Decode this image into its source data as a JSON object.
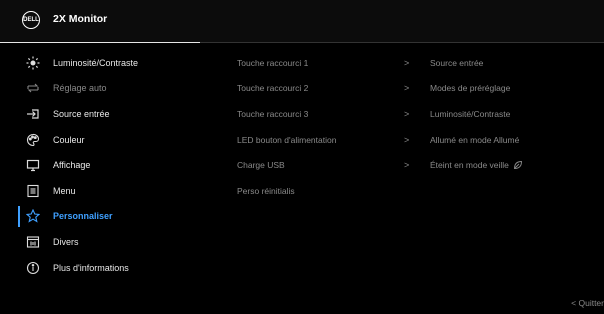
{
  "header": {
    "logo_text": "DELL",
    "title": "2X Monitor"
  },
  "sidebar": {
    "items": [
      {
        "label": "Luminosité/Contraste",
        "icon": "brightness-icon"
      },
      {
        "label": "Réglage auto",
        "icon": "auto-adjust-icon"
      },
      {
        "label": "Source entrée",
        "icon": "input-source-icon"
      },
      {
        "label": "Couleur",
        "icon": "color-palette-icon"
      },
      {
        "label": "Affichage",
        "icon": "display-icon"
      },
      {
        "label": "Menu",
        "icon": "menu-icon"
      },
      {
        "label": "Personnaliser",
        "icon": "star-icon"
      },
      {
        "label": "Divers",
        "icon": "others-icon"
      },
      {
        "label": "Plus d'informations",
        "icon": "info-icon"
      }
    ]
  },
  "middle": {
    "items": [
      {
        "label": "Touche raccourci 1",
        "chevron": ">"
      },
      {
        "label": "Touche raccourci 2",
        "chevron": ">"
      },
      {
        "label": "Touche raccourci 3",
        "chevron": ">"
      },
      {
        "label": "LED bouton d'alimentation",
        "chevron": ">"
      },
      {
        "label": "Charge USB",
        "chevron": ">"
      },
      {
        "label": "Perso réinitialis",
        "chevron": ""
      }
    ]
  },
  "right": {
    "items": [
      "Source entrée",
      "Modes de préréglage",
      "Luminosité/Contraste",
      "Allumé en mode Allumé",
      "Éteint en mode veille"
    ]
  },
  "footer": {
    "exit_label": "< Quitter"
  },
  "colors": {
    "accent": "#3fa0ff",
    "background": "#000000"
  }
}
